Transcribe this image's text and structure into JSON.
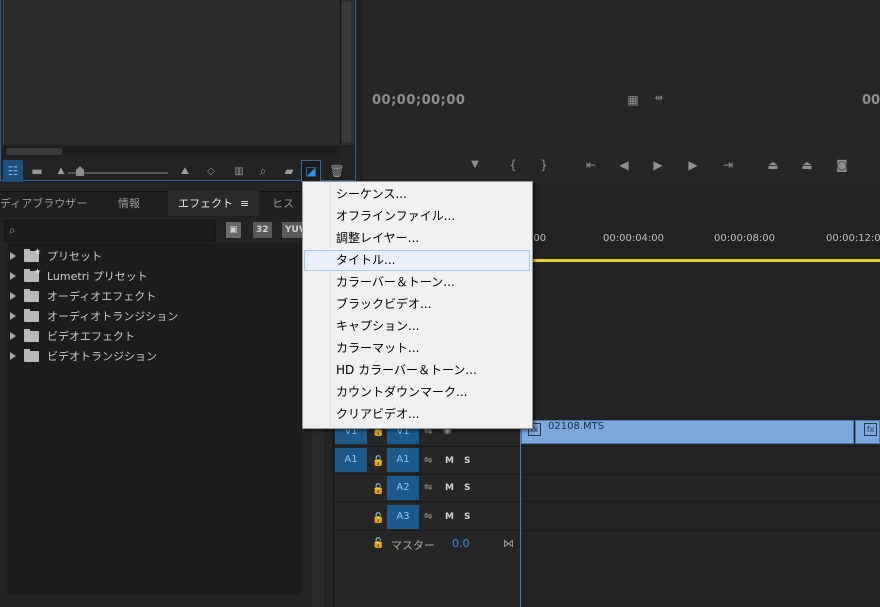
{
  "project_panel": {
    "toolbar_icons": [
      "list-view-icon",
      "icon-view-icon",
      "small-icon-mountain-icon",
      "zoom-slider-icon",
      "large-mountain-icon",
      "sort-icon",
      "automate-sequence-icon",
      "search-icon",
      "new-bin-icon",
      "new-item-icon",
      "trash-icon"
    ]
  },
  "program_monitor": {
    "timecode_left": "00;00;00;00",
    "timecode_right": "00",
    "controls": [
      "add-marker-icon",
      "mark-in-icon",
      "mark-out-icon",
      "go-to-in-icon",
      "step-back-icon",
      "play-icon",
      "step-forward-icon",
      "go-to-out-icon",
      "lift-icon",
      "extract-icon",
      "export-frame-icon"
    ]
  },
  "effects_panel": {
    "tabs": [
      {
        "label": "ディアブラウザー"
      },
      {
        "label": "情報"
      },
      {
        "label": "エフェクト"
      },
      {
        "label": "ヒス"
      }
    ],
    "tab_menu_icon": "≡",
    "badges": [
      "32",
      "YUV"
    ],
    "items": [
      {
        "label": "プリセット"
      },
      {
        "label": "Lumetri プリセット"
      },
      {
        "label": "オーディオエフェクト"
      },
      {
        "label": "オーディオトランジション"
      },
      {
        "label": "ビデオエフェクト"
      },
      {
        "label": "ビデオトランジション"
      }
    ]
  },
  "timeline": {
    "ruler": [
      ":00",
      "00:00:04:00",
      "00:00:08:00",
      "00:00:12:0"
    ],
    "clip_name": "02108.MTS",
    "tracks": {
      "v1_target": "V1",
      "v1": "V1",
      "a1_target": "A1",
      "a1": "A1",
      "a2": "A2",
      "a3": "A3",
      "mute": "M",
      "solo": "S"
    },
    "master_label": "マスター",
    "master_value": "0.0"
  },
  "context_menu": {
    "items": [
      {
        "label": "シーケンス..."
      },
      {
        "label": "オフラインファイル..."
      },
      {
        "label": "調整レイヤー..."
      },
      {
        "label": "タイトル..."
      },
      {
        "label": "カラーバー＆トーン..."
      },
      {
        "label": "ブラックビデオ..."
      },
      {
        "label": "キャプション..."
      },
      {
        "label": "カラーマット..."
      },
      {
        "label": "HD カラーバー＆トーン..."
      },
      {
        "label": "カウントダウンマーク..."
      },
      {
        "label": "クリアビデオ..."
      }
    ],
    "hovered_index": 3
  }
}
